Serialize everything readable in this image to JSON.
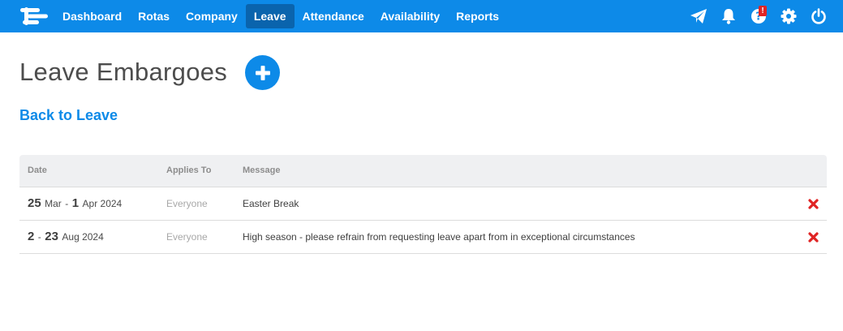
{
  "nav": {
    "items": [
      {
        "label": "Dashboard",
        "active": false
      },
      {
        "label": "Rotas",
        "active": false
      },
      {
        "label": "Company",
        "active": false
      },
      {
        "label": "Leave",
        "active": true
      },
      {
        "label": "Attendance",
        "active": false
      },
      {
        "label": "Availability",
        "active": false
      },
      {
        "label": "Reports",
        "active": false
      }
    ],
    "icons": [
      "send-icon",
      "bell-icon",
      "help-icon",
      "gear-icon",
      "power-icon"
    ],
    "help_badge": "!"
  },
  "page": {
    "title": "Leave Embargoes",
    "back_link": "Back to Leave"
  },
  "table": {
    "headers": {
      "date": "Date",
      "applies_to": "Applies To",
      "message": "Message"
    },
    "rows": [
      {
        "start_day": "25",
        "start_rest": "Mar",
        "sep": "-",
        "end_day": "1",
        "end_rest": "Apr 2024",
        "applies_to": "Everyone",
        "message": "Easter Break"
      },
      {
        "start_day": "2",
        "start_rest": "",
        "sep": "-",
        "end_day": "23",
        "end_rest": "Aug 2024",
        "applies_to": "Everyone",
        "message": "High season - please refrain from requesting leave apart from in exceptional circumstances"
      }
    ]
  },
  "colors": {
    "brand": "#0d8ae8",
    "nav_active": "#0a64ad",
    "delete": "#e02424"
  }
}
